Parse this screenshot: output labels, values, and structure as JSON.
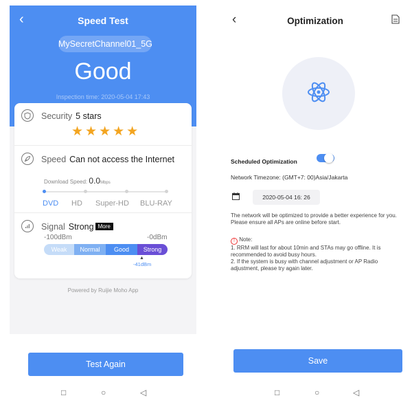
{
  "speed_test": {
    "title": "Speed Test",
    "ssid": "MySecretChannel01_5G",
    "rating": "Good",
    "inspection_time": "Inspection time: 2020-05-04 17:43",
    "security": {
      "label": "Security",
      "value": "5 stars",
      "stars": 5,
      "stars_text": "★★★★★"
    },
    "speed": {
      "label": "Speed",
      "value": "Can not access the Internet",
      "download_label": "Download Speed:",
      "download_value": "0.0",
      "download_unit": "Mbps",
      "qualities": [
        "DVD",
        "HD",
        "Super-HD",
        "BLU-RAY"
      ],
      "active_quality": "DVD"
    },
    "signal": {
      "label": "Signal",
      "value": "Strong",
      "more": "More",
      "min": "-100dBm",
      "max": "-0dBm",
      "levels": [
        "Weak",
        "Normal",
        "Good",
        "Strong"
      ],
      "reading": "-41dBm"
    },
    "powered_by": "Powered by Ruijie Moho App",
    "test_again": "Test Again"
  },
  "optimization": {
    "title": "Optimization",
    "scheduled_label": "Scheduled Optimization",
    "scheduled_on": true,
    "timezone": "Network Timezone: (GMT+7: 00)Asia/Jakarta",
    "date": "2020-05-04 16: 26",
    "description": "The network will be optimized to provide a better experience for you. Please ensure all APs are online before start.",
    "note_title": "Note:",
    "note_1": "1. RRM will last for about 10min and STAs may go offline. It is recommended to avoid busy hours.",
    "note_2": "2. If the system is busy with channel adjustment or AP Radio adjustment, please try again later.",
    "save": "Save"
  },
  "colors": {
    "accent": "#4d8ef2",
    "star": "#f3a521",
    "weak": "#c5dcf8",
    "normal": "#7fb0f2",
    "good": "#4d8ef2",
    "strong": "#6a4fd6"
  },
  "icons": [
    "back-icon",
    "shield-icon",
    "rocket-icon",
    "signal-icon",
    "document-icon",
    "atom-icon",
    "calendar-icon",
    "warning-icon",
    "nav-square-icon",
    "nav-circle-icon",
    "nav-back-icon"
  ]
}
